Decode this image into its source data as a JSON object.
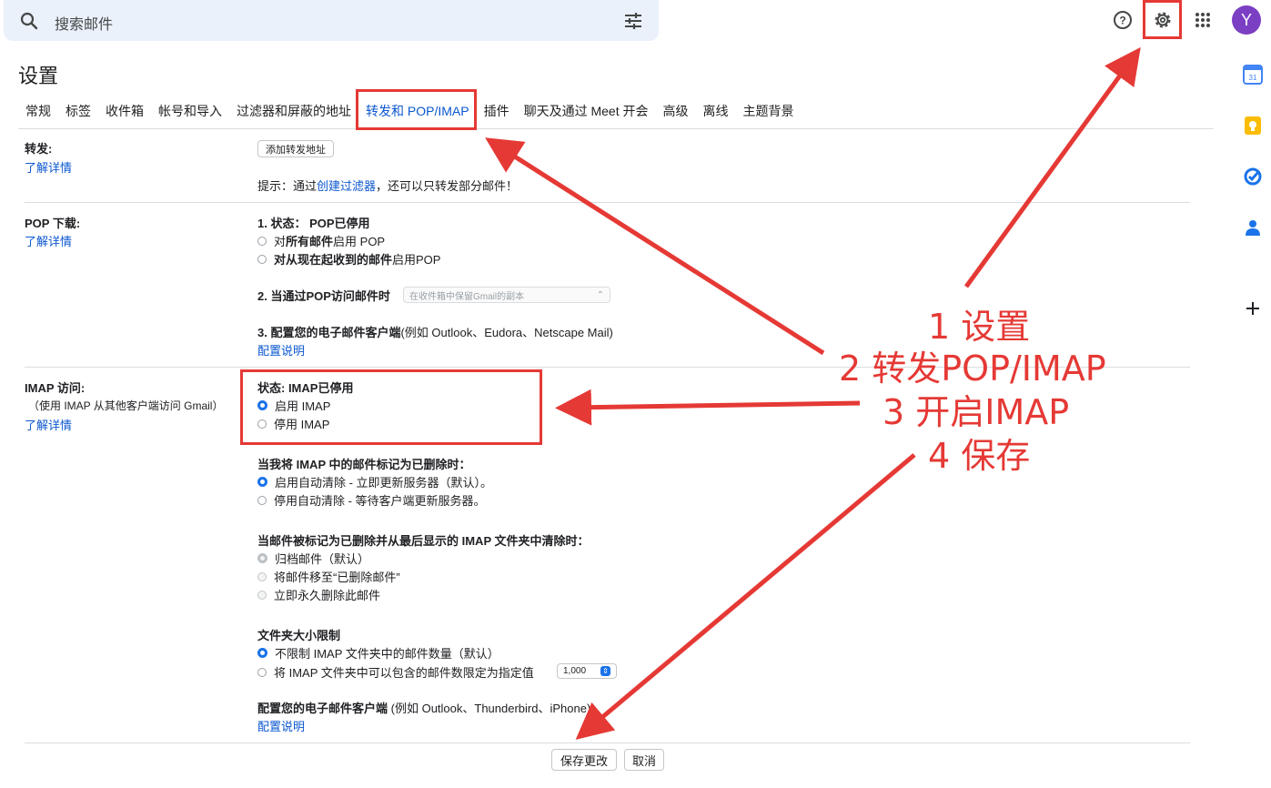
{
  "header": {
    "search_placeholder": "搜索邮件",
    "avatar_letter": "Y",
    "calendar_day": "31"
  },
  "settings": {
    "title": "设置",
    "tabs": [
      "常规",
      "标签",
      "收件箱",
      "帐号和导入",
      "过滤器和屏蔽的地址",
      "转发和 POP/IMAP",
      "插件",
      "聊天及通过 Meet 开会",
      "高级",
      "离线",
      "主题背景"
    ],
    "active_tab": "转发和 POP/IMAP"
  },
  "forwarding": {
    "title": "转发:",
    "learn_more": "了解详情",
    "add_button": "添加转发地址",
    "tip_prefix": "提示：通过",
    "tip_link": "创建过滤器",
    "tip_suffix": "，还可以只转发部分邮件！"
  },
  "pop": {
    "title": "POP 下载:",
    "learn_more": "了解详情",
    "status_label": "1. 状态：",
    "status_value": "POP已停用",
    "option_all_prefix": "对",
    "option_all_bold": "所有邮件",
    "option_all_suffix": "启用 POP",
    "option_now_bold": "对从现在起收到的邮件",
    "option_now_suffix": "启用POP",
    "access_label": "2. 当通过POP访问邮件时",
    "access_select": "在收件箱中保留Gmail的副本",
    "client_label": "3. 配置您的电子邮件客户端",
    "client_examples": "(例如 Outlook、Eudora、Netscape Mail)",
    "config_link": "配置说明"
  },
  "imap": {
    "title": "IMAP 访问:",
    "subtitle": "（使用 IMAP 从其他客户端访问 Gmail）",
    "learn_more": "了解详情",
    "status": "状态: IMAP已停用",
    "enable": "启用 IMAP",
    "disable": "停用 IMAP",
    "deleted_heading": "当我将 IMAP 中的邮件标记为已删除时：",
    "auto_expunge_on": "启用自动清除 - 立即更新服务器（默认）。",
    "auto_expunge_off": "停用自动清除 - 等待客户端更新服务器。",
    "expunge_heading": "当邮件被标记为已删除并从最后显示的 IMAP 文件夹中清除时：",
    "archive": "归档邮件（默认）",
    "move_trash": "将邮件移至“已删除邮件”",
    "delete_forever": "立即永久删除此邮件",
    "size_heading": "文件夹大小限制",
    "no_limit": "不限制 IMAP 文件夹中的邮件数量（默认）",
    "limit_label": "将 IMAP 文件夹中可以包含的邮件数限定为指定值",
    "limit_value": "1,000",
    "client_heading": "配置您的电子邮件客户端",
    "client_examples": "(例如 Outlook、Thunderbird、iPhone)",
    "config_link": "配置说明"
  },
  "footer": {
    "save": "保存更改",
    "cancel": "取消"
  },
  "annotations": {
    "step1": "1 设置",
    "step2": "2 转发POP/IMAP",
    "step3": "3 开启IMAP",
    "step4": "4 保存",
    "color": "#e53935"
  }
}
